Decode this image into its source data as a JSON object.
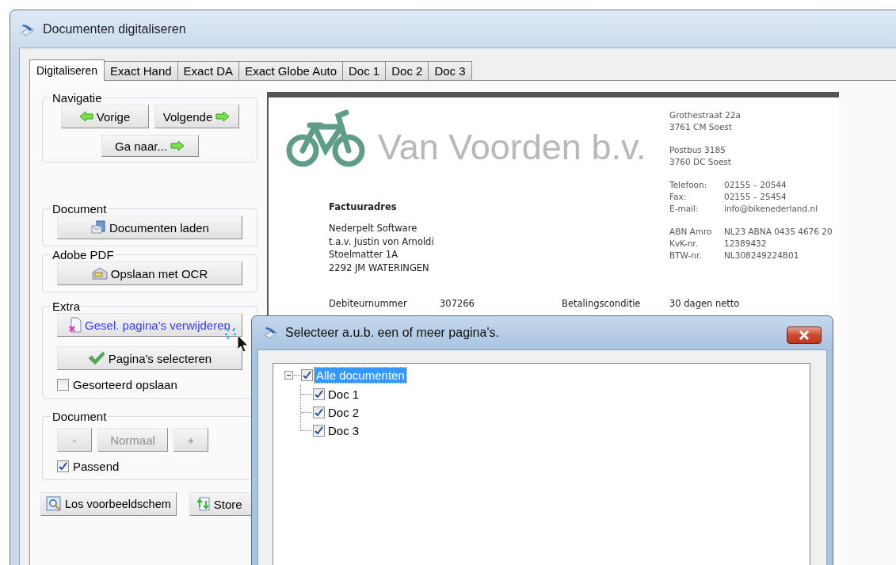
{
  "window": {
    "title": "Documenten digitaliseren"
  },
  "tabs": [
    {
      "label": "Digitaliseren",
      "selected": true
    },
    {
      "label": "Exact Hand",
      "selected": false
    },
    {
      "label": "Exact DA",
      "selected": false
    },
    {
      "label": "Exact Globe Auto",
      "selected": false
    },
    {
      "label": "Doc 1",
      "selected": false
    },
    {
      "label": "Doc 2",
      "selected": false
    },
    {
      "label": "Doc 3",
      "selected": false
    }
  ],
  "navigation": {
    "title": "Navigatie",
    "buttons": [
      {
        "label": "Vorige",
        "kind": "back"
      },
      {
        "label": "Volgende",
        "kind": "forward"
      },
      {
        "label": "Ga naar...",
        "kind": "forward"
      }
    ]
  },
  "document_group": {
    "title": "Document",
    "button": "Documenten laden"
  },
  "pdf_group": {
    "title": "Adobe PDF",
    "button": "Opslaan met OCR"
  },
  "extra_group": {
    "title": "Extra",
    "buttons": [
      {
        "label": "Gesel. pagina's verwijderen",
        "hovered": true
      },
      {
        "label": "Pagina's selecteren",
        "hovered": false
      }
    ],
    "checkbox": {
      "label": "Gesorteerd opslaan",
      "checked": false
    }
  },
  "zoom_group": {
    "title": "Document",
    "buttons": [
      {
        "label": "-",
        "disabled": true
      },
      {
        "label": "Normaal",
        "disabled": true
      },
      {
        "label": "+",
        "disabled": true
      }
    ],
    "checkbox": {
      "label": "Passend",
      "checked": true
    }
  },
  "bottom_buttons": [
    {
      "label": "Los voorbeeldschem"
    },
    {
      "label": "Store"
    }
  ],
  "preview": {
    "company": "Van Voorden b.v.",
    "address_blocks": [
      [
        "Grothestraat 22a",
        "3761 CM  Soest"
      ],
      [
        "Postbus 3185",
        "3760 DC  Soest"
      ]
    ],
    "info_blocks": [
      [
        {
          "label": "Telefoon:",
          "value": "02155 – 20544"
        },
        {
          "label": "Fax:",
          "value": "02155 – 25454"
        },
        {
          "label": "E-mail:",
          "value": "info@bikenederland.nl"
        }
      ],
      [
        {
          "label": "ABN Amro",
          "value": "NL23 ABNA 0435 4676 20"
        },
        {
          "label": "KvK-nr.",
          "value": "12389432"
        },
        {
          "label": "BTW-nr.",
          "value": "NL308249224B01"
        }
      ]
    ],
    "invoice_address": {
      "heading": "Factuuradres",
      "lines": [
        "Nederpelt Software",
        "t.a.v. Justin von Arnoldi",
        "Stoelmatter 1A",
        "2292 JM  WATERINGEN"
      ]
    },
    "details": [
      {
        "label": "Debiteurnummer",
        "value": "307266"
      },
      {
        "label": "Betalingsconditie",
        "value": "30 dagen netto"
      }
    ]
  },
  "dialog": {
    "title": "Selecteer a.u.b. een of meer pagina's.",
    "tree": {
      "label": "Alle documenten",
      "checked": true,
      "selected": true,
      "expanded": true,
      "children": [
        {
          "label": "Doc 1",
          "checked": true,
          "selected": false
        },
        {
          "label": "Doc 2",
          "checked": true,
          "selected": false
        },
        {
          "label": "Doc 3",
          "checked": true,
          "selected": false
        }
      ]
    }
  }
}
